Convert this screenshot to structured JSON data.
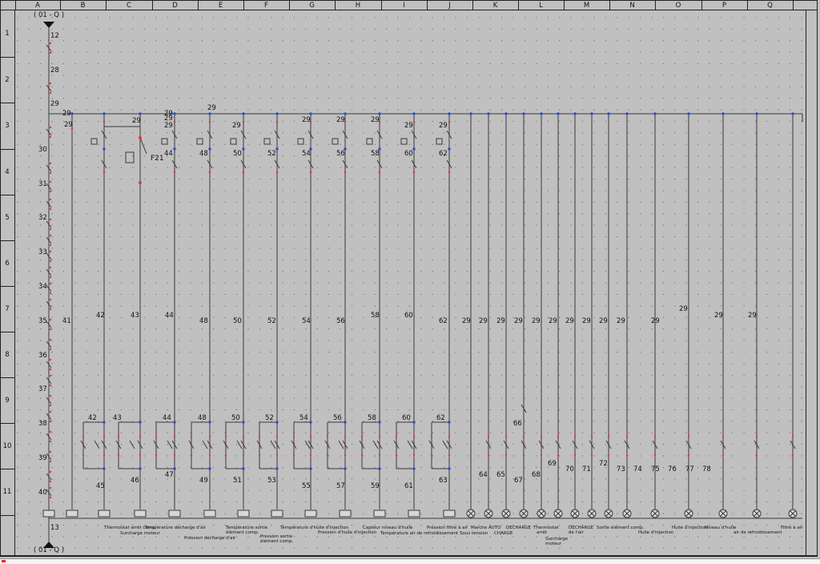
{
  "sheet": {
    "top_ref": "( 01 - Q )",
    "bottom_ref": "( 01 - Q )",
    "columns": [
      "A",
      "B",
      "C",
      "D",
      "E",
      "F",
      "G",
      "H",
      "I",
      "J",
      "K",
      "L",
      "M",
      "N",
      "O",
      "P",
      "Q"
    ],
    "rows": [
      "1",
      "2",
      "3",
      "4",
      "5",
      "6",
      "7",
      "8",
      "9",
      "10",
      "11"
    ]
  },
  "left_rail": {
    "top_numbers": [
      "12",
      "28",
      "29"
    ],
    "row_numbers": [
      "30",
      "31",
      "32",
      "33",
      "34",
      "35",
      "36",
      "37",
      "38",
      "39",
      "40"
    ],
    "bottom_number": "13",
    "f21_label": "F21"
  },
  "top_wire_numbers": [
    "29",
    "29",
    "29",
    "29",
    "29",
    "29",
    "29",
    "29",
    "29",
    "29",
    "29",
    "29",
    "29"
  ],
  "mid_wire_numbers": [
    "41",
    "42",
    "43",
    "44",
    "48",
    "50",
    "52",
    "54",
    "56",
    "58",
    "60",
    "62",
    "29",
    "29",
    "29",
    "29",
    "29",
    "29",
    "29",
    "29",
    "29",
    "29",
    "29",
    "29",
    "29",
    "29"
  ],
  "bottom_wire_numbers": [
    "45",
    "46",
    "47",
    "49",
    "51",
    "53",
    "55",
    "57",
    "59",
    "61",
    "63",
    "64",
    "65",
    "67",
    "68",
    "69",
    "70",
    "71",
    "72",
    "73",
    "74",
    "75",
    "76",
    "77",
    "78"
  ],
  "upper_wire_numbers": [
    "42",
    "43",
    "44",
    "48",
    "50",
    "52",
    "54",
    "56",
    "58",
    "60",
    "62",
    "66",
    "44",
    "48",
    "50",
    "52",
    "54",
    "56",
    "58",
    "60",
    "62"
  ],
  "bottom_labels": [
    "Thermostat arrêt comp.",
    "Surcharge moteur",
    "Température décharge d'air",
    "Pression décharge d'air",
    "Température sortie",
    "élément comp.",
    "Pression sortie",
    "élément comp.",
    "Température d'huile d'injection",
    "Pression d'huile d'injection",
    "Capteur niveau d'huile",
    "Température air de refroidissement",
    "Pression filtre à air",
    "Marche",
    "Sous tension",
    "AUTO",
    "CHARGE",
    "DECHARGE",
    "Thermostat",
    "arrêt",
    "Surcharge",
    "moteur",
    "DECHARGE",
    "de l'air",
    "Sortie élément comp.",
    "Huile d'injection",
    "Huile d'injection",
    "Niveau d'huile",
    "air de refroidissement",
    "Filtre à air"
  ]
}
